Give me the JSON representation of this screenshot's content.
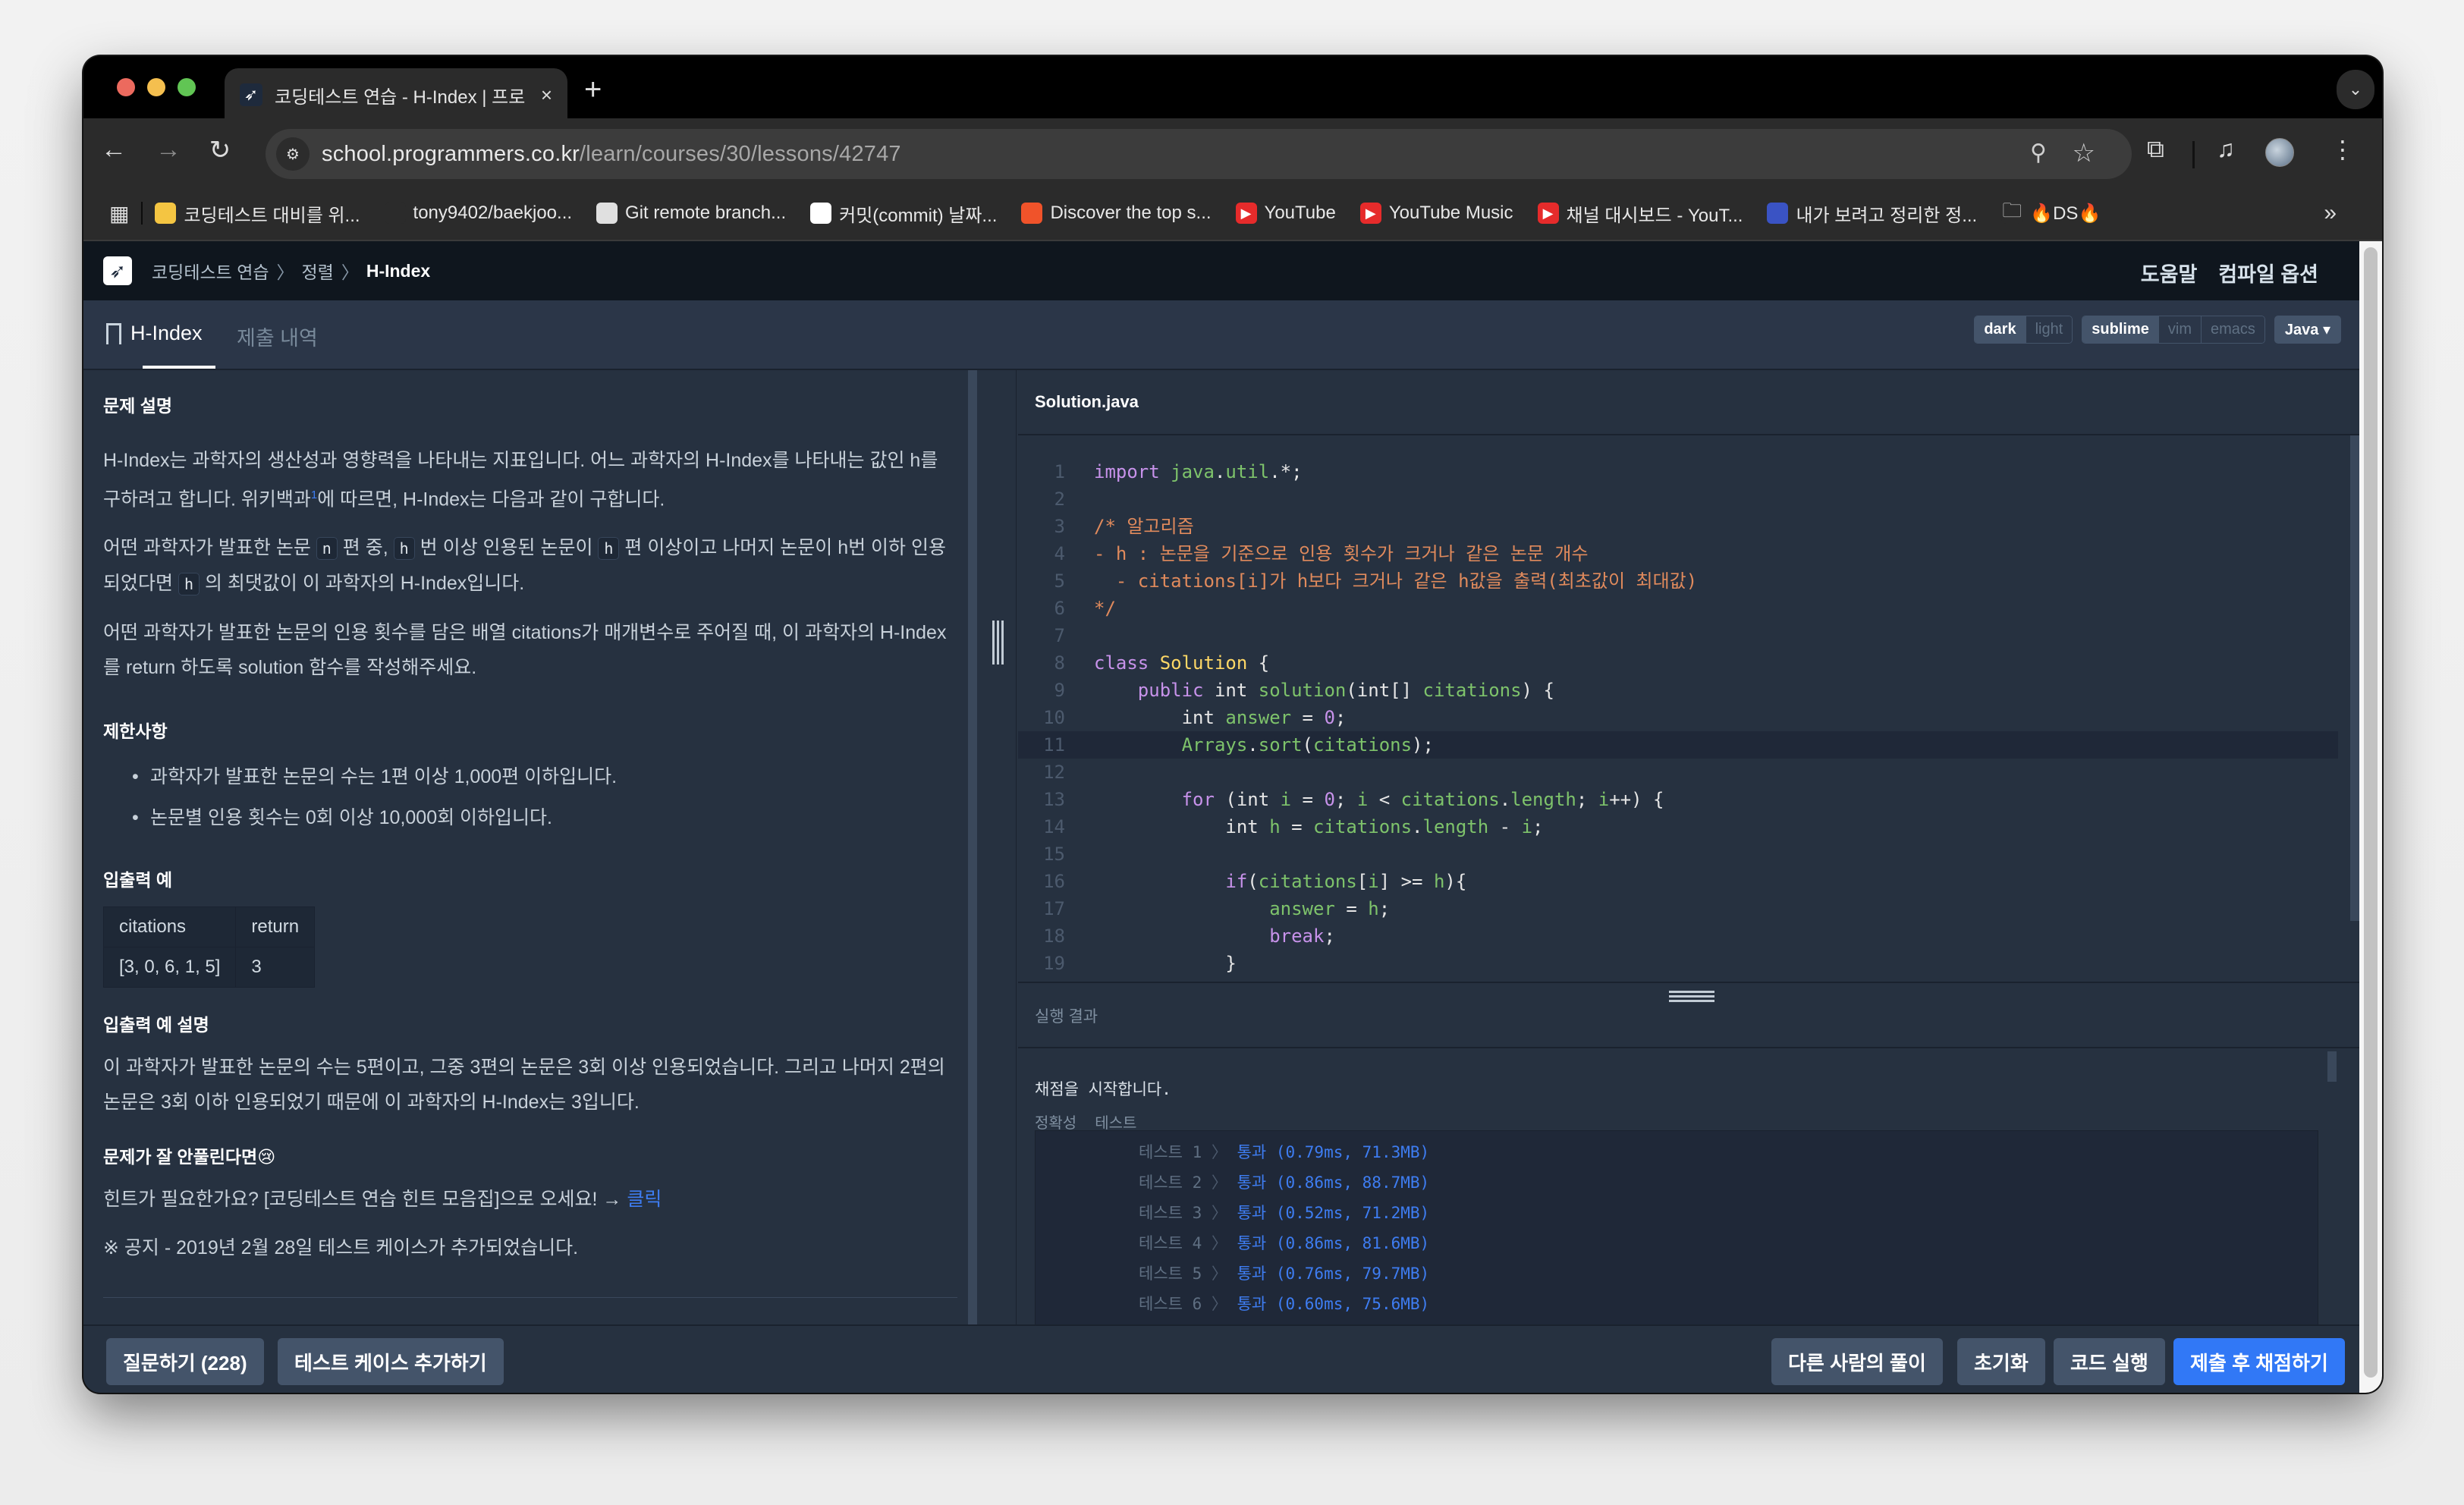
{
  "browser": {
    "tab_title": "코딩테스트 연습 - H-Index | 프로",
    "tab_close": "×",
    "new_tab": "+",
    "url_host": "school.programmers.co.kr",
    "url_path": "/learn/courses/30/lessons/42747",
    "bookmarks": [
      {
        "label": "코딩테스트 대비를 위...",
        "icon": "coin-icon",
        "color": "#f4c542"
      },
      {
        "label": "tony9402/baekjoo...",
        "icon": "github-icon",
        "color": "#2b2b2b"
      },
      {
        "label": "Git remote branch...",
        "icon": "penguin-icon",
        "color": "#e0e0e0"
      },
      {
        "label": "커밋(commit) 날짜...",
        "icon": "dragon-icon",
        "color": "#ffffff"
      },
      {
        "label": "Discover the top s...",
        "icon": "soundcloud-icon",
        "color": "#f0532a"
      },
      {
        "label": "YouTube",
        "icon": "youtube-icon",
        "color": "#e62b2b"
      },
      {
        "label": "YouTube Music",
        "icon": "youtube-music-icon",
        "color": "#e62b2b"
      },
      {
        "label": "채널 대시보드 - YouT...",
        "icon": "youtube-icon",
        "color": "#e62b2b"
      },
      {
        "label": "내가 보려고 정리한 정...",
        "icon": "notebook-icon",
        "color": "#3a53c4"
      },
      {
        "label": "🔥DS🔥",
        "icon": "folder-icon",
        "color": "#2b2b2b"
      }
    ],
    "bookmarks_more": "»"
  },
  "header": {
    "breadcrumbs": [
      "코딩테스트 연습",
      "정렬",
      "H-Index"
    ],
    "links": [
      "도움말",
      "컴파일 옵션"
    ]
  },
  "lesson_tabs": [
    {
      "label": "H-Index",
      "active": true
    },
    {
      "label": "제출 내역",
      "active": false
    }
  ],
  "editor_options": {
    "theme": [
      "dark",
      "light"
    ],
    "theme_selected": "dark",
    "keymap": [
      "sublime",
      "vim",
      "emacs"
    ],
    "keymap_selected": "sublime",
    "language": "Java"
  },
  "problem": {
    "description_title": "문제 설명",
    "p1_a": "H-Index는 과학자의 생산성과 영향력을 나타내는 지표입니다. 어느 과학자의 H-Index를 나타내는 값인 h를 구하려고 합니다. 위키백과",
    "p1_sup": "1",
    "p1_b": "에 따르면, H-Index는 다음과 같이 구합니다.",
    "p2_parts": [
      "어떤 과학자가 발표한 논문 ",
      "n",
      " 편 중, ",
      "h",
      " 번 이상 인용된 논문이 ",
      "h",
      " 편 이상이고 나머지 논문이 h번 이하 인용되었다면 ",
      "h",
      " 의 최댓값이 이 과학자의 H-Index입니다."
    ],
    "p3": "어떤 과학자가 발표한 논문의 인용 횟수를 담은 배열 citations가 매개변수로 주어질 때, 이 과학자의 H-Index를 return 하도록 solution 함수를 작성해주세요.",
    "constraints_title": "제한사항",
    "constraints": [
      "과학자가 발표한 논문의 수는 1편 이상 1,000편 이하입니다.",
      "논문별 인용 횟수는 0회 이상 10,000회 이하입니다."
    ],
    "io_title": "입출력 예",
    "io_headers": [
      "citations",
      "return"
    ],
    "io_rows": [
      [
        "[3, 0, 6, 1, 5]",
        "3"
      ]
    ],
    "io_explain_title": "입출력 예 설명",
    "io_explain": "이 과학자가 발표한 논문의 수는 5편이고, 그중 3편의 논문은 3회 이상 인용되었습니다. 그리고 나머지 2편의 논문은 3회 이하 인용되었기 때문에 이 과학자의 H-Index는 3입니다.",
    "hint_title": "문제가 잘 안풀린다면😢",
    "hint_text": "힌트가 필요한가요? [코딩테스트 연습 힌트 모음집]으로 오세요! → ",
    "hint_link": "클릭",
    "notice": "※ 공지 - 2019년 2월 28일 테스트 케이스가 추가되었습니다."
  },
  "editor": {
    "filename": "Solution.java",
    "active_line": 11,
    "lines": [
      [
        [
          "kw",
          "import"
        ],
        [
          "tx",
          " "
        ],
        [
          "pk",
          "java"
        ],
        [
          "tx",
          "."
        ],
        [
          "pk",
          "util"
        ],
        [
          "tx",
          ".*;"
        ]
      ],
      [],
      [
        [
          "cm",
          "/* 알고리즘"
        ]
      ],
      [
        [
          "cm",
          "- h : 논문을 기준으로 인용 횟수가 크거나 같은 논문 개수"
        ]
      ],
      [
        [
          "cm",
          "  - citations[i]가 h보다 크거나 같은 h값을 출력(최초값이 최대값)"
        ]
      ],
      [
        [
          "cm",
          "*/"
        ]
      ],
      [],
      [
        [
          "kw",
          "class"
        ],
        [
          "tx",
          " "
        ],
        [
          "cls",
          "Solution"
        ],
        [
          "tx",
          " {"
        ]
      ],
      [
        [
          "tx",
          "    "
        ],
        [
          "kw",
          "public"
        ],
        [
          "tx",
          " int "
        ],
        [
          "id",
          "solution"
        ],
        [
          "tx",
          "(int[] "
        ],
        [
          "id",
          "citations"
        ],
        [
          "tx",
          ") {"
        ]
      ],
      [
        [
          "tx",
          "        int "
        ],
        [
          "id",
          "answer"
        ],
        [
          "tx",
          " = "
        ],
        [
          "num",
          "0"
        ],
        [
          "tx",
          ";"
        ]
      ],
      [
        [
          "tx",
          "        "
        ],
        [
          "id",
          "Arrays"
        ],
        [
          "tx",
          "."
        ],
        [
          "id",
          "sort"
        ],
        [
          "tx",
          "("
        ],
        [
          "id",
          "citations"
        ],
        [
          "tx",
          ");"
        ]
      ],
      [],
      [
        [
          "tx",
          "        "
        ],
        [
          "kw",
          "for"
        ],
        [
          "tx",
          " (int "
        ],
        [
          "id",
          "i"
        ],
        [
          "tx",
          " = "
        ],
        [
          "num",
          "0"
        ],
        [
          "tx",
          "; "
        ],
        [
          "id",
          "i"
        ],
        [
          "tx",
          " < "
        ],
        [
          "id",
          "citations"
        ],
        [
          "tx",
          "."
        ],
        [
          "id",
          "length"
        ],
        [
          "tx",
          "; "
        ],
        [
          "id",
          "i"
        ],
        [
          "tx",
          "++) {"
        ]
      ],
      [
        [
          "tx",
          "            int "
        ],
        [
          "id",
          "h"
        ],
        [
          "tx",
          " = "
        ],
        [
          "id",
          "citations"
        ],
        [
          "tx",
          "."
        ],
        [
          "id",
          "length"
        ],
        [
          "tx",
          " - "
        ],
        [
          "id",
          "i"
        ],
        [
          "tx",
          ";"
        ]
      ],
      [],
      [
        [
          "tx",
          "            "
        ],
        [
          "kw",
          "if"
        ],
        [
          "tx",
          "("
        ],
        [
          "id",
          "citations"
        ],
        [
          "tx",
          "["
        ],
        [
          "id",
          "i"
        ],
        [
          "tx",
          "] >= "
        ],
        [
          "id",
          "h"
        ],
        [
          "tx",
          "){"
        ]
      ],
      [
        [
          "tx",
          "                "
        ],
        [
          "id",
          "answer"
        ],
        [
          "tx",
          " = "
        ],
        [
          "id",
          "h"
        ],
        [
          "tx",
          ";"
        ]
      ],
      [
        [
          "tx",
          "                "
        ],
        [
          "kw",
          "break"
        ],
        [
          "tx",
          ";"
        ]
      ],
      [
        [
          "tx",
          "            }"
        ]
      ],
      [
        [
          "tx",
          "        }"
        ]
      ]
    ]
  },
  "result": {
    "title": "실행 결과",
    "start_message": "채점을 시작합니다.",
    "headings": [
      "정확성",
      "테스트"
    ],
    "tests": [
      {
        "label": "테스트 1",
        "status": "통과",
        "time": "0.79ms",
        "memory": "71.3MB"
      },
      {
        "label": "테스트 2",
        "status": "통과",
        "time": "0.86ms",
        "memory": "88.7MB"
      },
      {
        "label": "테스트 3",
        "status": "통과",
        "time": "0.52ms",
        "memory": "71.2MB"
      },
      {
        "label": "테스트 4",
        "status": "통과",
        "time": "0.86ms",
        "memory": "81.6MB"
      },
      {
        "label": "테스트 5",
        "status": "통과",
        "time": "0.76ms",
        "memory": "79.7MB"
      },
      {
        "label": "테스트 6",
        "status": "통과",
        "time": "0.60ms",
        "memory": "75.6MB"
      }
    ]
  },
  "footer": {
    "left_buttons": [
      "질문하기 (228)",
      "테스트 케이스 추가하기"
    ],
    "right_buttons": [
      "다른 사람의 풀이",
      "초기화",
      "코드 실행",
      "제출 후 채점하기"
    ]
  },
  "colors": {
    "accent": "#3178f6",
    "page_bg": "#263140",
    "header_bg": "#0f161e",
    "pass": "#3e7df2"
  }
}
